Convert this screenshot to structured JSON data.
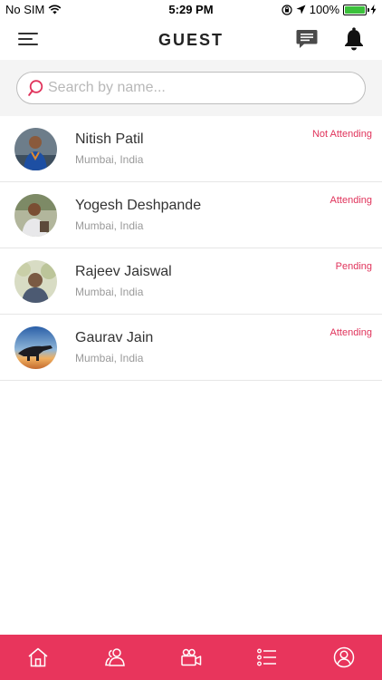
{
  "status_bar": {
    "carrier": "No SIM",
    "time": "5:29 PM",
    "battery": "100%"
  },
  "header": {
    "title": "GUEST"
  },
  "search": {
    "placeholder": "Search by name...",
    "value": ""
  },
  "guests": [
    {
      "name": "Nitish Patil",
      "location": "Mumbai, India",
      "status": "Not Attending"
    },
    {
      "name": "Yogesh Deshpande",
      "location": "Mumbai, India",
      "status": "Attending"
    },
    {
      "name": "Rajeev Jaiswal",
      "location": "Mumbai, India",
      "status": "Pending"
    },
    {
      "name": "Gaurav Jain",
      "location": "Mumbai, India",
      "status": "Attending"
    }
  ],
  "tab_bar": {
    "tabs": [
      {
        "icon": "home-icon"
      },
      {
        "icon": "guests-icon"
      },
      {
        "icon": "video-icon"
      },
      {
        "icon": "list-icon"
      },
      {
        "icon": "profile-icon"
      }
    ]
  },
  "colors": {
    "accent": "#e8355c",
    "status_text": "#e0335b",
    "battery": "#3bc13b"
  }
}
